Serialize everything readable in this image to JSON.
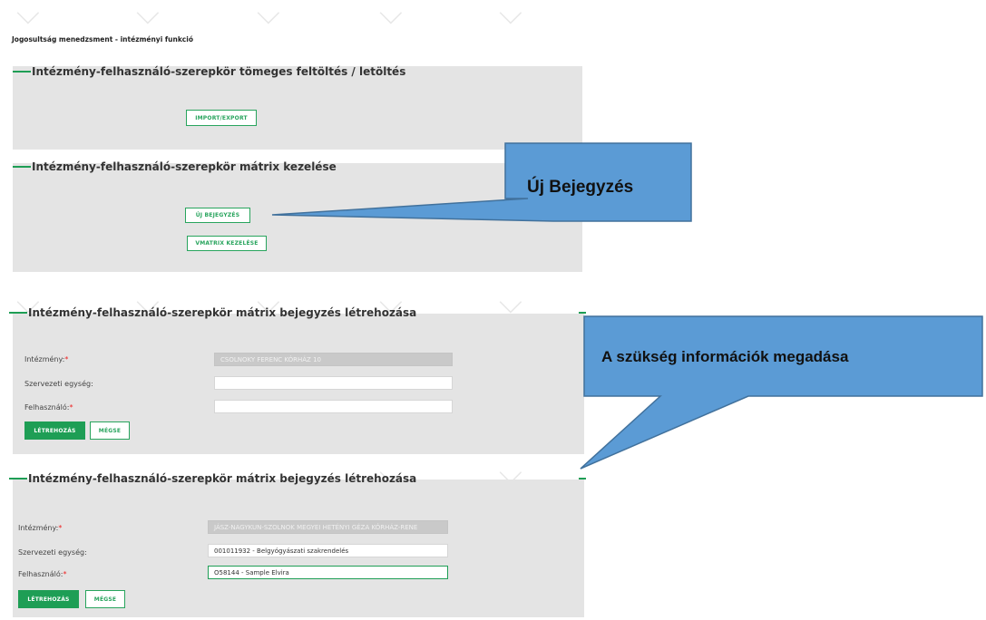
{
  "page": {
    "title": "Jogosultság menedzsment - intézményi funkció"
  },
  "sections": {
    "bulk": {
      "title": "Intézmény-felhasználó-szerepkör tömeges feltöltés / letöltés",
      "import_export_label": "IMPORT/EXPORT"
    },
    "matrix": {
      "title": "Intézmény-felhasználó-szerepkör mátrix kezelése",
      "new_entry_label": "ÚJ BEJEGYZÉS",
      "vmatrix_label": "VMATRIX KEZELÉSE"
    },
    "create_empty": {
      "title": "Intézmény-felhasználó-szerepkör mátrix bejegyzés létrehozása",
      "institution_label": "Intézmény:",
      "institution_value": "CSOLNOKY FERENC KÓRHÁZ 10",
      "org_unit_label": "Szervezeti egység:",
      "org_unit_value": "",
      "user_label": "Felhasználó:",
      "user_value": "",
      "create_label": "LÉTREHOZÁS",
      "cancel_label": "MÉGSE"
    },
    "create_filled": {
      "title": "Intézmény-felhasználó-szerepkör mátrix bejegyzés létrehozása",
      "institution_label": "Intézmény:",
      "institution_value": "JÁSZ-NAGYKUN-SZOLNOK MEGYEI HETÉNYI GÉZA KÓRHÁZ-RENE",
      "org_unit_label": "Szervezeti egység:",
      "org_unit_value": "001011932 - Belgyógyászati szakrendelés",
      "user_label": "Felhasználó:",
      "user_value": "O58144 - Sample Elvira",
      "create_label": "LÉTREHOZÁS",
      "cancel_label": "MÉGSE"
    }
  },
  "required_mark": "*",
  "callouts": {
    "new_entry": "Új Bejegyzés",
    "info": "A szükség információk megadása"
  },
  "colors": {
    "accent": "#1e9e55",
    "callout_fill": "#5b9bd5",
    "callout_stroke": "#41719c",
    "panel": "#e4e4e4"
  }
}
